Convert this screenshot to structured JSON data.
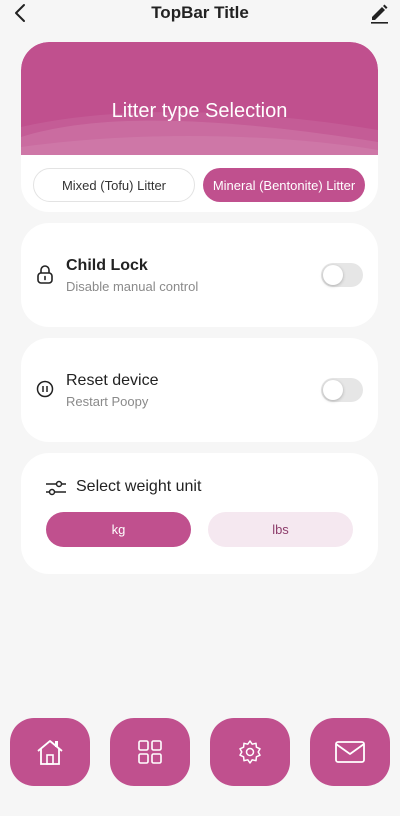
{
  "topbar": {
    "title": "TopBar Title",
    "back_icon": "chevron-left-icon",
    "edit_icon": "pencil-icon"
  },
  "litter": {
    "title": "Litter type Selection",
    "options": [
      "Mixed (Tofu) Litter",
      "Mineral (Bentonite) Litter"
    ],
    "selected": "Mineral (Bentonite) Litter"
  },
  "child_lock": {
    "title": "Child Lock",
    "subtitle": "Disable manual control",
    "enabled": false,
    "icon": "lock-icon"
  },
  "reset": {
    "title": "Reset device",
    "subtitle": "Restart Poopy",
    "enabled": false,
    "icon": "pause-circle-icon"
  },
  "weight": {
    "title": "Select weight unit",
    "icon": "sliders-icon",
    "options": [
      "kg",
      "lbs"
    ],
    "selected": "kg"
  },
  "nav": {
    "items": [
      "home-icon",
      "grid-icon",
      "gear-icon",
      "mail-icon"
    ]
  },
  "colors": {
    "accent": "#c0508e",
    "accent_light": "#f5e8f0",
    "background": "#f6f6f6"
  }
}
